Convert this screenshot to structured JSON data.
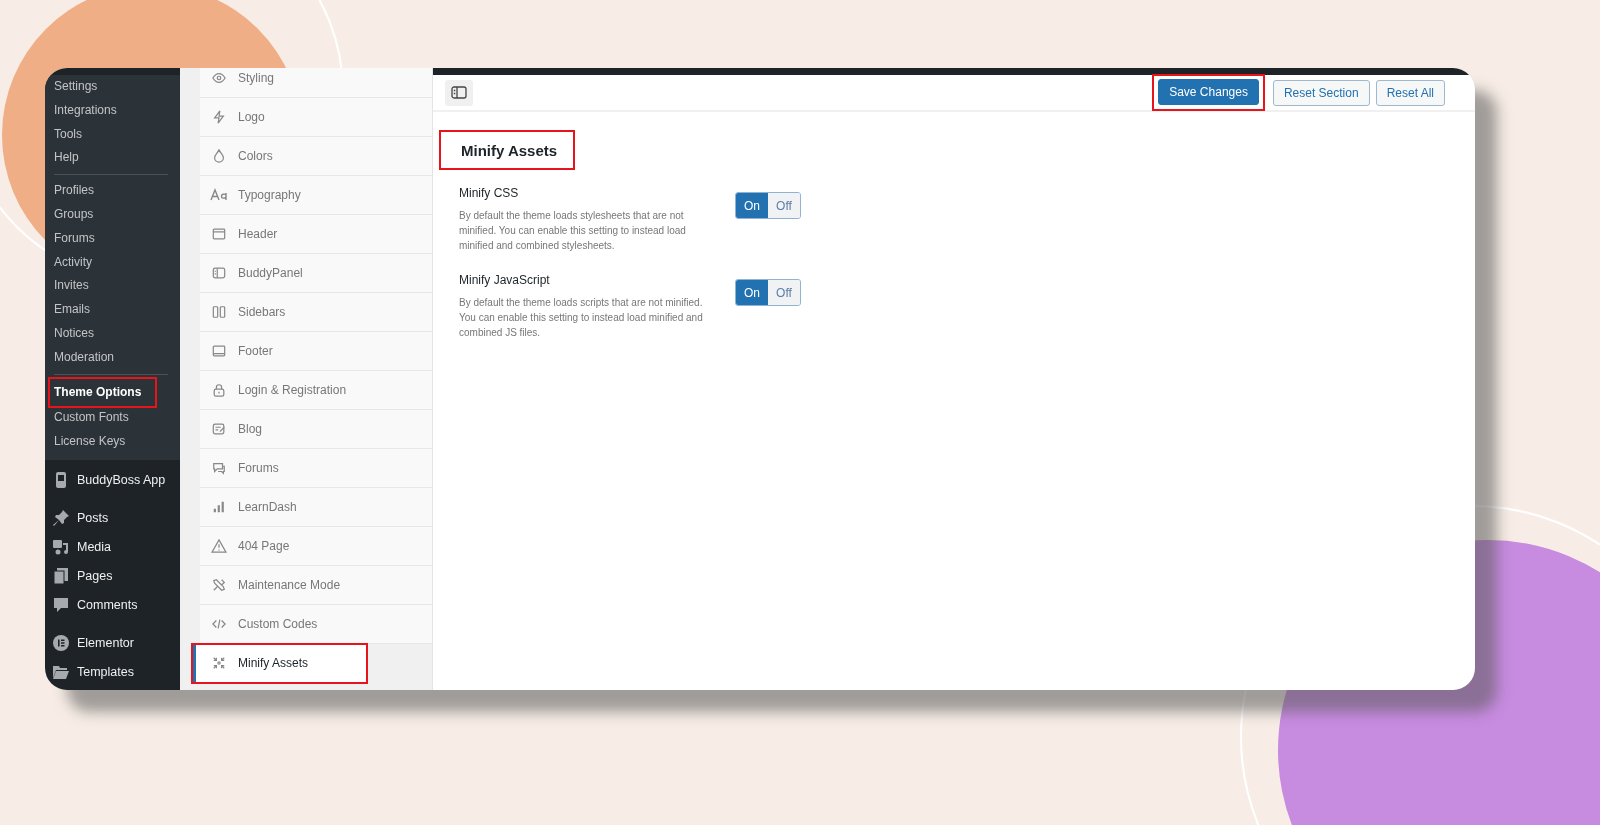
{
  "sidebar": {
    "submenu_groups": [
      [
        "Settings",
        "Integrations",
        "Tools",
        "Help"
      ],
      [
        "Profiles",
        "Groups",
        "Forums",
        "Activity",
        "Invites",
        "Emails",
        "Notices",
        "Moderation"
      ]
    ],
    "current_group": [
      {
        "label": "Theme Options",
        "selected": true,
        "highlighted": true
      },
      {
        "label": "Custom Fonts",
        "selected": false,
        "highlighted": false
      },
      {
        "label": "License Keys",
        "selected": false,
        "highlighted": false
      }
    ],
    "menu_groups": [
      [
        "BuddyBoss App"
      ],
      [
        "Posts",
        "Media",
        "Pages",
        "Comments"
      ],
      [
        "Elementor",
        "Templates"
      ]
    ]
  },
  "options_nav": [
    {
      "label": "Styling",
      "selected": false,
      "highlighted": false
    },
    {
      "label": "Logo",
      "selected": false,
      "highlighted": false
    },
    {
      "label": "Colors",
      "selected": false,
      "highlighted": false
    },
    {
      "label": "Typography",
      "selected": false,
      "highlighted": false
    },
    {
      "label": "Header",
      "selected": false,
      "highlighted": false
    },
    {
      "label": "BuddyPanel",
      "selected": false,
      "highlighted": false
    },
    {
      "label": "Sidebars",
      "selected": false,
      "highlighted": false
    },
    {
      "label": "Footer",
      "selected": false,
      "highlighted": false
    },
    {
      "label": "Login & Registration",
      "selected": false,
      "highlighted": false
    },
    {
      "label": "Blog",
      "selected": false,
      "highlighted": false
    },
    {
      "label": "Forums",
      "selected": false,
      "highlighted": false
    },
    {
      "label": "LearnDash",
      "selected": false,
      "highlighted": false
    },
    {
      "label": "404 Page",
      "selected": false,
      "highlighted": false
    },
    {
      "label": "Maintenance Mode",
      "selected": false,
      "highlighted": false
    },
    {
      "label": "Custom Codes",
      "selected": false,
      "highlighted": false
    },
    {
      "label": "Minify Assets",
      "selected": true,
      "highlighted": true
    }
  ],
  "toolbar": {
    "buttons": [
      {
        "label": "Save Changes",
        "kind": "primary",
        "highlighted": true
      },
      {
        "label": "Reset Section",
        "kind": "secondary",
        "highlighted": false
      },
      {
        "label": "Reset All",
        "kind": "secondary",
        "highlighted": false
      }
    ]
  },
  "section": {
    "title": "Minify Assets",
    "highlighted": true,
    "options": [
      {
        "title": "Minify CSS",
        "description": "By default the theme loads stylesheets that are not minified. You can enable this setting to instead load minified and combined stylesheets.",
        "on": true,
        "on_label": "On",
        "off_label": "Off"
      },
      {
        "title": "Minify JavaScript",
        "description": "By default the theme loads scripts that are not minified. You can enable this setting to instead load minified and combined JS files.",
        "on": true,
        "on_label": "On",
        "off_label": "Off"
      }
    ]
  }
}
